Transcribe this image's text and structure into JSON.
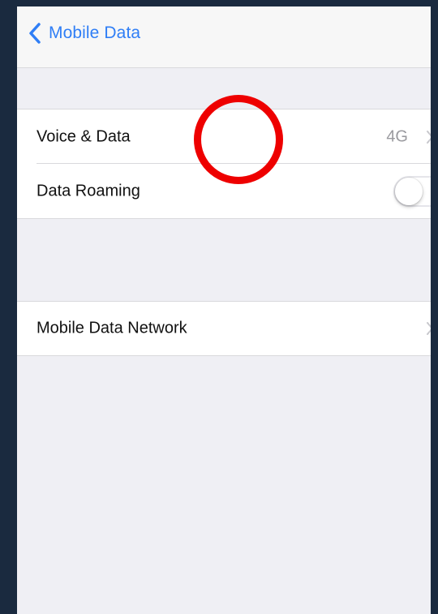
{
  "navbar": {
    "back_label": "Mobile Data",
    "back_icon": "chevron-left-icon"
  },
  "group1": {
    "voice_data": {
      "label": "Voice & Data",
      "value": "4G"
    },
    "data_roaming": {
      "label": "Data Roaming",
      "toggle_on": false
    }
  },
  "group2": {
    "mobile_data_network": {
      "label": "Mobile Data Network"
    }
  },
  "colors": {
    "accent": "#2f7ef6",
    "background": "#efeff4",
    "frame": "#1a2a3f",
    "annotation": "#ee0000"
  }
}
